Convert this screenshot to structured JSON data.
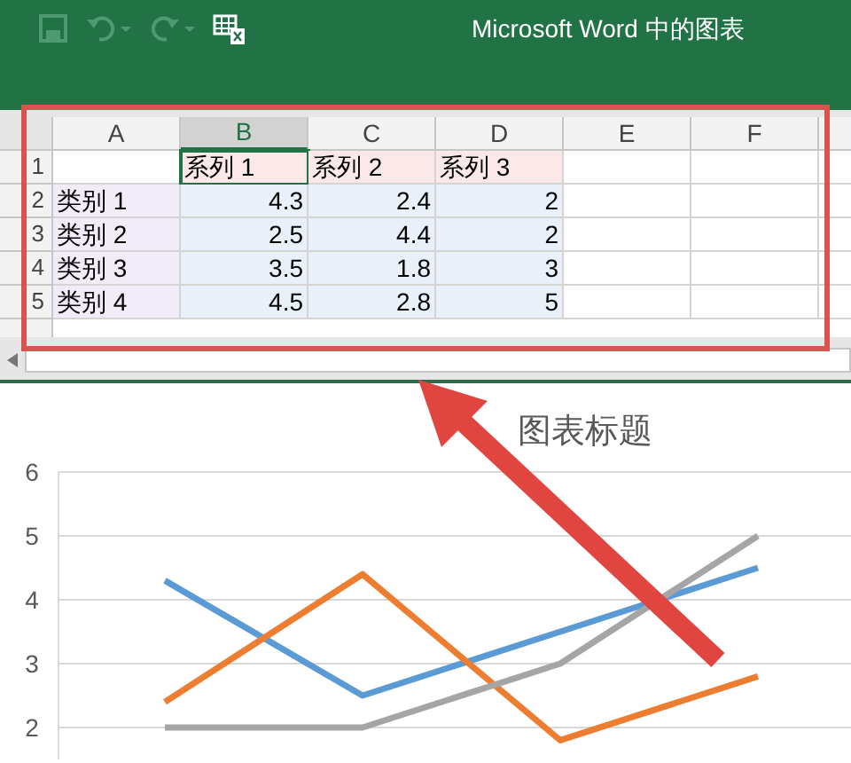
{
  "title_bar": {
    "title": "Microsoft Word 中的图表",
    "quick_access": [
      {
        "kind": "save",
        "disabled": true
      },
      {
        "kind": "undo",
        "disabled": true
      },
      {
        "kind": "redo",
        "disabled": true
      },
      {
        "kind": "sheet",
        "disabled": false
      }
    ]
  },
  "sheet": {
    "columns": [
      {
        "label": "A",
        "selected": false
      },
      {
        "label": "B",
        "selected": true
      },
      {
        "label": "C",
        "selected": false
      },
      {
        "label": "D",
        "selected": false
      },
      {
        "label": "E",
        "selected": false
      },
      {
        "label": "F",
        "selected": false
      }
    ],
    "rows": [
      {
        "number": "1",
        "cells": [
          {
            "text": "",
            "kind": "blank",
            "selected": false
          },
          {
            "text": "系列 1",
            "kind": "series",
            "selected": true
          },
          {
            "text": "系列 2",
            "kind": "series",
            "selected": false
          },
          {
            "text": "系列 3",
            "kind": "series",
            "selected": false
          },
          {
            "text": "",
            "kind": "blank",
            "selected": false
          },
          {
            "text": "",
            "kind": "blank",
            "selected": false
          }
        ]
      },
      {
        "number": "2",
        "cells": [
          {
            "text": "类别 1",
            "kind": "category",
            "selected": false
          },
          {
            "text": "4.3",
            "kind": "value",
            "selected": false
          },
          {
            "text": "2.4",
            "kind": "value",
            "selected": false
          },
          {
            "text": "2",
            "kind": "value",
            "selected": false
          },
          {
            "text": "",
            "kind": "blank",
            "selected": false
          },
          {
            "text": "",
            "kind": "blank",
            "selected": false
          }
        ]
      },
      {
        "number": "3",
        "cells": [
          {
            "text": "类别 2",
            "kind": "category",
            "selected": false
          },
          {
            "text": "2.5",
            "kind": "value",
            "selected": false
          },
          {
            "text": "4.4",
            "kind": "value",
            "selected": false
          },
          {
            "text": "2",
            "kind": "value",
            "selected": false
          },
          {
            "text": "",
            "kind": "blank",
            "selected": false
          },
          {
            "text": "",
            "kind": "blank",
            "selected": false
          }
        ]
      },
      {
        "number": "4",
        "cells": [
          {
            "text": "类别 3",
            "kind": "category",
            "selected": false
          },
          {
            "text": "3.5",
            "kind": "value",
            "selected": false
          },
          {
            "text": "1.8",
            "kind": "value",
            "selected": false
          },
          {
            "text": "3",
            "kind": "value",
            "selected": false
          },
          {
            "text": "",
            "kind": "blank",
            "selected": false
          },
          {
            "text": "",
            "kind": "blank",
            "selected": false
          }
        ]
      },
      {
        "number": "5",
        "cells": [
          {
            "text": "类别 4",
            "kind": "category",
            "selected": false
          },
          {
            "text": "4.5",
            "kind": "value",
            "selected": false
          },
          {
            "text": "2.8",
            "kind": "value",
            "selected": false
          },
          {
            "text": "5",
            "kind": "value",
            "selected": false
          },
          {
            "text": "",
            "kind": "blank",
            "selected": false
          },
          {
            "text": "",
            "kind": "blank",
            "selected": false
          }
        ]
      }
    ]
  },
  "chart": {
    "chart_data": {
      "type": "line",
      "title": "图表标题",
      "yticks": [
        2,
        3,
        4,
        5,
        6
      ],
      "ylim": [
        1.5,
        6
      ],
      "grid": true,
      "series": [
        {
          "color": "#5b9bd5",
          "values": [
            4.3,
            2.5,
            3.5,
            4.5
          ]
        },
        {
          "color": "#ed7d31",
          "values": [
            2.4,
            4.4,
            1.8,
            2.8
          ]
        },
        {
          "color": "#a5a5a5",
          "values": [
            2,
            2,
            3,
            5
          ]
        }
      ]
    }
  }
}
